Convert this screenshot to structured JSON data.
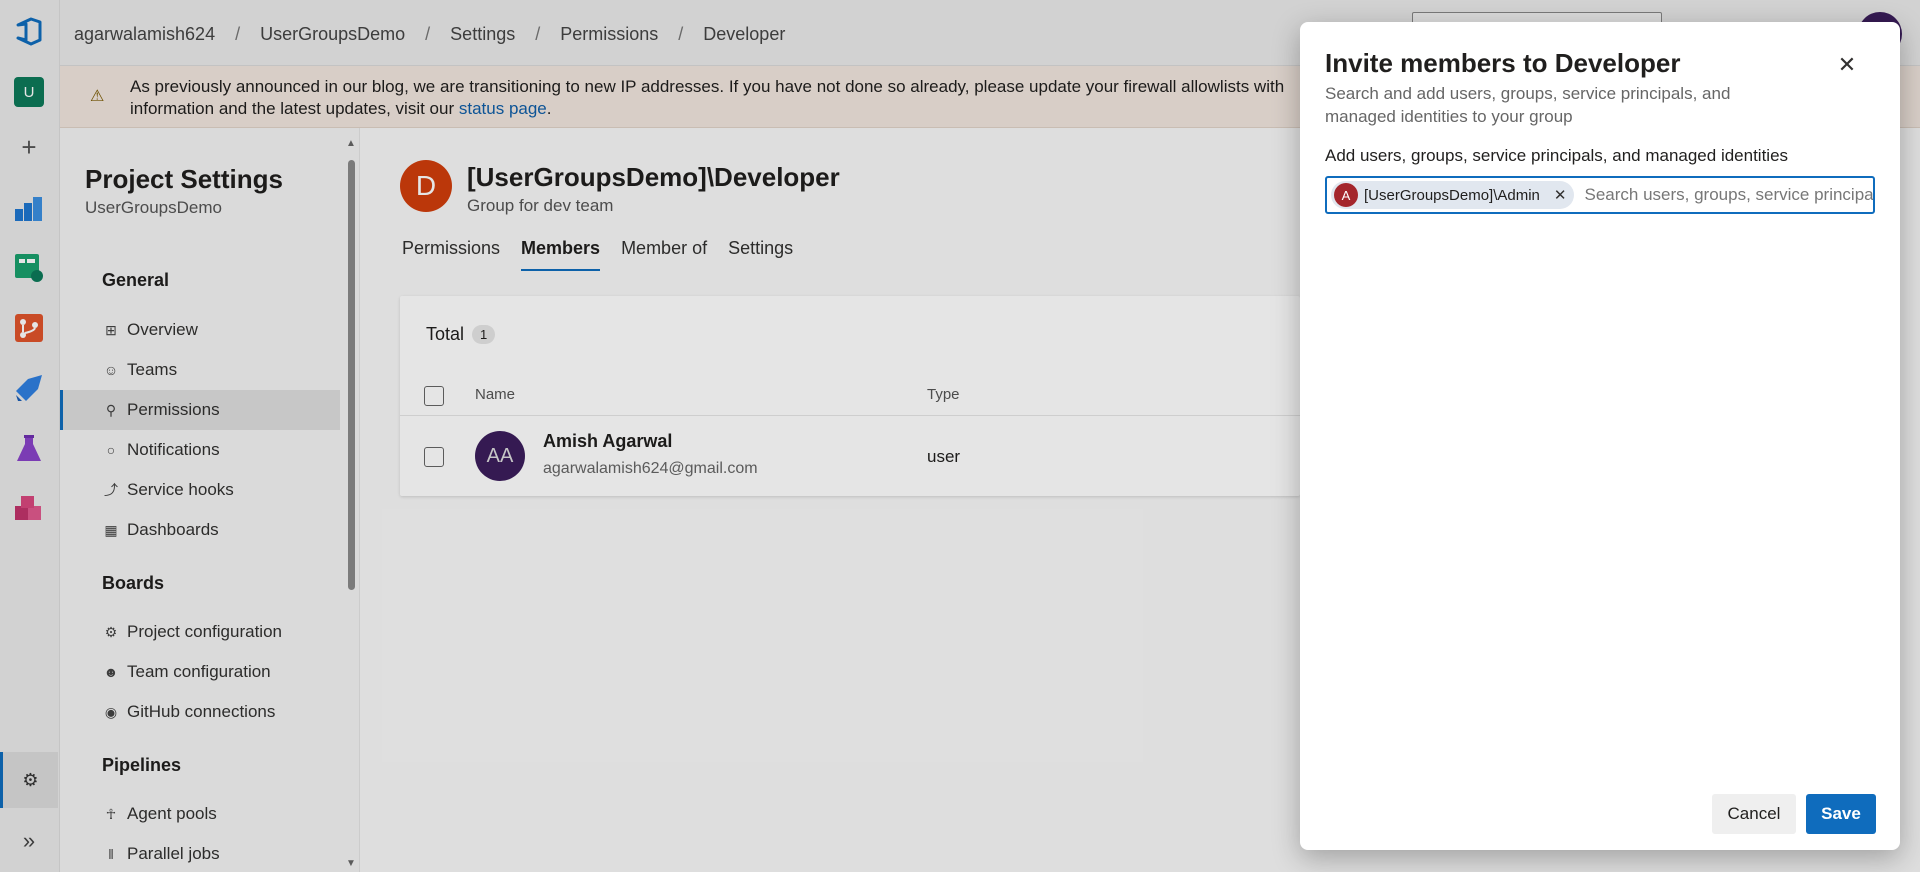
{
  "breadcrumb": {
    "items": [
      "agarwalamish624",
      "UserGroupsDemo",
      "Settings",
      "Permissions",
      "Developer"
    ],
    "separator": "/"
  },
  "banner": {
    "text": "As previously announced in our blog, we are transitioning to new IP addresses. If you have not done so already, please update your firewall allowlists with",
    "text2": "information and the latest updates, visit our ",
    "link": "status page",
    "text_end": "."
  },
  "rail": {
    "project_initial": "U",
    "add_icon": "+",
    "collapse_icon": "»"
  },
  "sidebar": {
    "title": "Project Settings",
    "subtitle": "UserGroupsDemo",
    "sections": [
      {
        "label": "General"
      },
      {
        "label": "Boards"
      },
      {
        "label": "Pipelines"
      }
    ],
    "general_items": [
      {
        "label": "Overview",
        "icon": "overview-icon"
      },
      {
        "label": "Teams",
        "icon": "teams-icon"
      },
      {
        "label": "Permissions",
        "icon": "lock-icon",
        "active": true
      },
      {
        "label": "Notifications",
        "icon": "notification-icon"
      },
      {
        "label": "Service hooks",
        "icon": "service-hooks-icon"
      },
      {
        "label": "Dashboards",
        "icon": "dashboards-icon"
      }
    ],
    "boards_items": [
      {
        "label": "Project configuration",
        "icon": "project-config-icon"
      },
      {
        "label": "Team configuration",
        "icon": "team-config-icon"
      },
      {
        "label": "GitHub connections",
        "icon": "github-icon"
      }
    ],
    "pipelines_items": [
      {
        "label": "Agent pools",
        "icon": "agent-pools-icon"
      },
      {
        "label": "Parallel jobs",
        "icon": "parallel-jobs-icon"
      }
    ]
  },
  "group": {
    "initial": "D",
    "title": "[UserGroupsDemo]\\Developer",
    "description": "Group for dev team",
    "avatar_color": "#d13e0c"
  },
  "tabs": [
    {
      "label": "Permissions"
    },
    {
      "label": "Members",
      "active": true
    },
    {
      "label": "Member of"
    },
    {
      "label": "Settings"
    }
  ],
  "members": {
    "total_label": "Total",
    "total_count": "1",
    "columns": {
      "name": "Name",
      "type": "Type"
    },
    "rows": [
      {
        "initials": "AA",
        "name": "Amish Agarwal",
        "email": "agarwalamish624@gmail.com",
        "type": "user"
      }
    ]
  },
  "dialog": {
    "title": "Invite members to Developer",
    "subtitle": "Search and add users, groups, service principals, and managed identities to your group",
    "field_label": "Add users, groups, service principals, and managed identities",
    "chip": {
      "initial": "A",
      "label": "[UserGroupsDemo]\\Admin"
    },
    "search_placeholder": "Search users, groups, service principals",
    "cancel_label": "Cancel",
    "save_label": "Save"
  },
  "colors": {
    "accent": "#0f6cbd",
    "group_avatar": "#d13e0c",
    "member_avatar": "#3b1d5c",
    "chip_avatar": "#a4262c"
  }
}
